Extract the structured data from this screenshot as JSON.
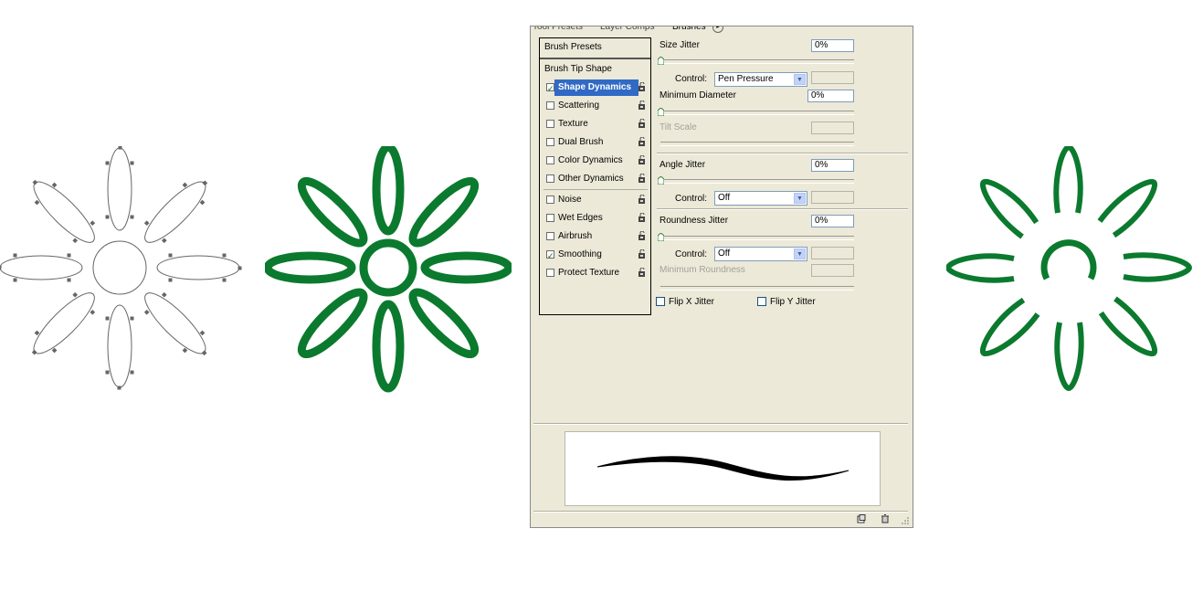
{
  "panel": {
    "tabs": [
      "Tool Presets",
      "Layer Comps",
      "Brushes"
    ],
    "brush_presets_label": "Brush Presets",
    "brush_tip_shape_label": "Brush Tip Shape",
    "items": [
      {
        "label": "Shape Dynamics",
        "checked": true,
        "selected": true
      },
      {
        "label": "Scattering",
        "checked": false
      },
      {
        "label": "Texture",
        "checked": false
      },
      {
        "label": "Dual Brush",
        "checked": false
      },
      {
        "label": "Color Dynamics",
        "checked": false
      },
      {
        "label": "Other Dynamics",
        "checked": false
      },
      {
        "label": "Noise",
        "checked": false
      },
      {
        "label": "Wet Edges",
        "checked": false
      },
      {
        "label": "Airbrush",
        "checked": false
      },
      {
        "label": "Smoothing",
        "checked": true
      },
      {
        "label": "Protect Texture",
        "checked": false
      }
    ],
    "size_jitter": {
      "label": "Size Jitter",
      "value": "0%"
    },
    "size_control": {
      "label": "Control:",
      "value": "Pen Pressure"
    },
    "minimum_diameter": {
      "label": "Minimum Diameter",
      "value": "0%"
    },
    "tilt_scale": {
      "label": "Tilt Scale"
    },
    "angle_jitter": {
      "label": "Angle Jitter",
      "value": "0%"
    },
    "angle_control": {
      "label": "Control:",
      "value": "Off"
    },
    "roundness_jitter": {
      "label": "Roundness Jitter",
      "value": "0%"
    },
    "roundness_control": {
      "label": "Control:",
      "value": "Off"
    },
    "minimum_roundness": {
      "label": "Minimum Roundness"
    },
    "flip_x": {
      "label": "Flip X Jitter",
      "checked": false
    },
    "flip_y": {
      "label": "Flip Y Jitter",
      "checked": false
    }
  },
  "colors": {
    "flower_green": "#0b7a2e",
    "selection_blue": "#316ac5",
    "panel_bg": "#ece9d8"
  }
}
